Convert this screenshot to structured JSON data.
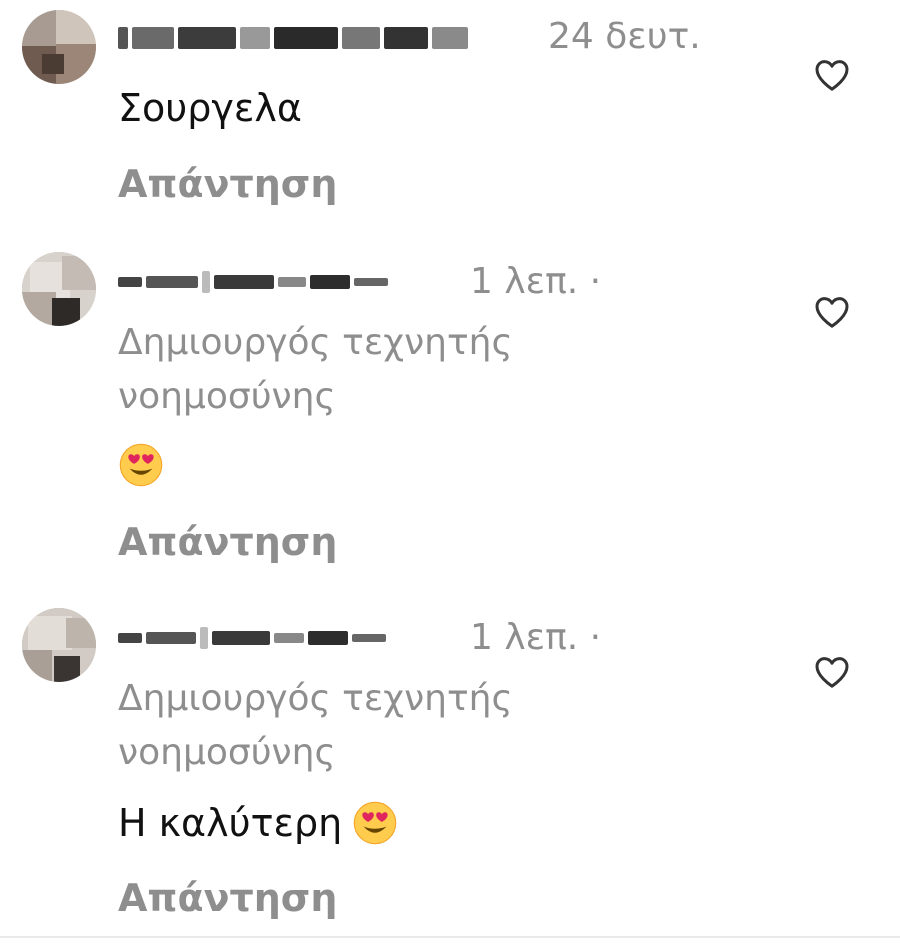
{
  "comments": [
    {
      "timestamp": "24 δευτ.",
      "text": "Σουργελα",
      "reply_label": "Απάντηση",
      "has_emoji": false
    },
    {
      "timestamp": "1 λεπ. ·",
      "subtitle": "Δημιουργός τεχνητής νοημοσύνης",
      "emoji_name": "heart-eyes-emoji",
      "reply_label": "Απάντηση"
    },
    {
      "timestamp": "1 λεπ. ·",
      "subtitle": "Δημιουργός τεχνητής νοημοσύνης",
      "text": "Η καλύτερη",
      "emoji_name": "heart-eyes-emoji",
      "reply_label": "Απάντηση"
    }
  ],
  "colors": {
    "text_primary": "#111111",
    "text_secondary": "#8e8e8e",
    "background": "#ffffff"
  },
  "icons": {
    "like": "heart-outline-icon"
  }
}
